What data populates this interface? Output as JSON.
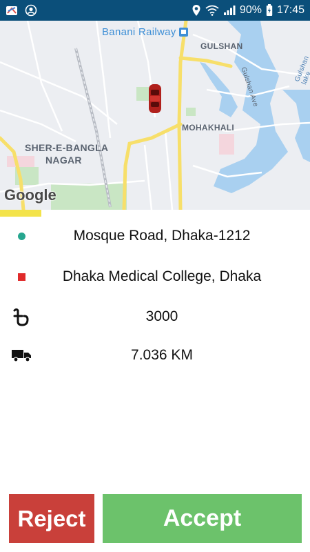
{
  "status_bar": {
    "battery": "90%",
    "time": "17:45",
    "icons": [
      "app-icon",
      "account-icon",
      "location-icon",
      "wifi-icon",
      "signal-icon",
      "battery-icon"
    ]
  },
  "map": {
    "labels": {
      "station": "Banani Railway",
      "gulshan": "GULSHAN",
      "gulshan_ave": "Gulshan Ave",
      "gulshan_lake": "Gulshan lake",
      "mohakhali": "MOHAKHALI",
      "sher_line1": "SHER-E-BANGLA",
      "sher_line2": "NAGAR"
    },
    "logo": "Google",
    "colors": {
      "land": "#eceef2",
      "water": "#a9d0f0",
      "park": "#c9e6c4",
      "road": "#f7df6a"
    }
  },
  "trip": {
    "pickup": "Mosque Road, Dhaka-1212",
    "dropoff": "Dhaka Medical College, Dhaka",
    "fare": "3000",
    "distance": "7.036 KM"
  },
  "actions": {
    "reject": "Reject",
    "accept": "Accept"
  },
  "colors": {
    "status_bar": "#0b4f7a",
    "pickup_marker": "#26a68f",
    "dropoff_marker": "#e02a2a",
    "reject": "#c9403a",
    "accept": "#6cc26b"
  }
}
